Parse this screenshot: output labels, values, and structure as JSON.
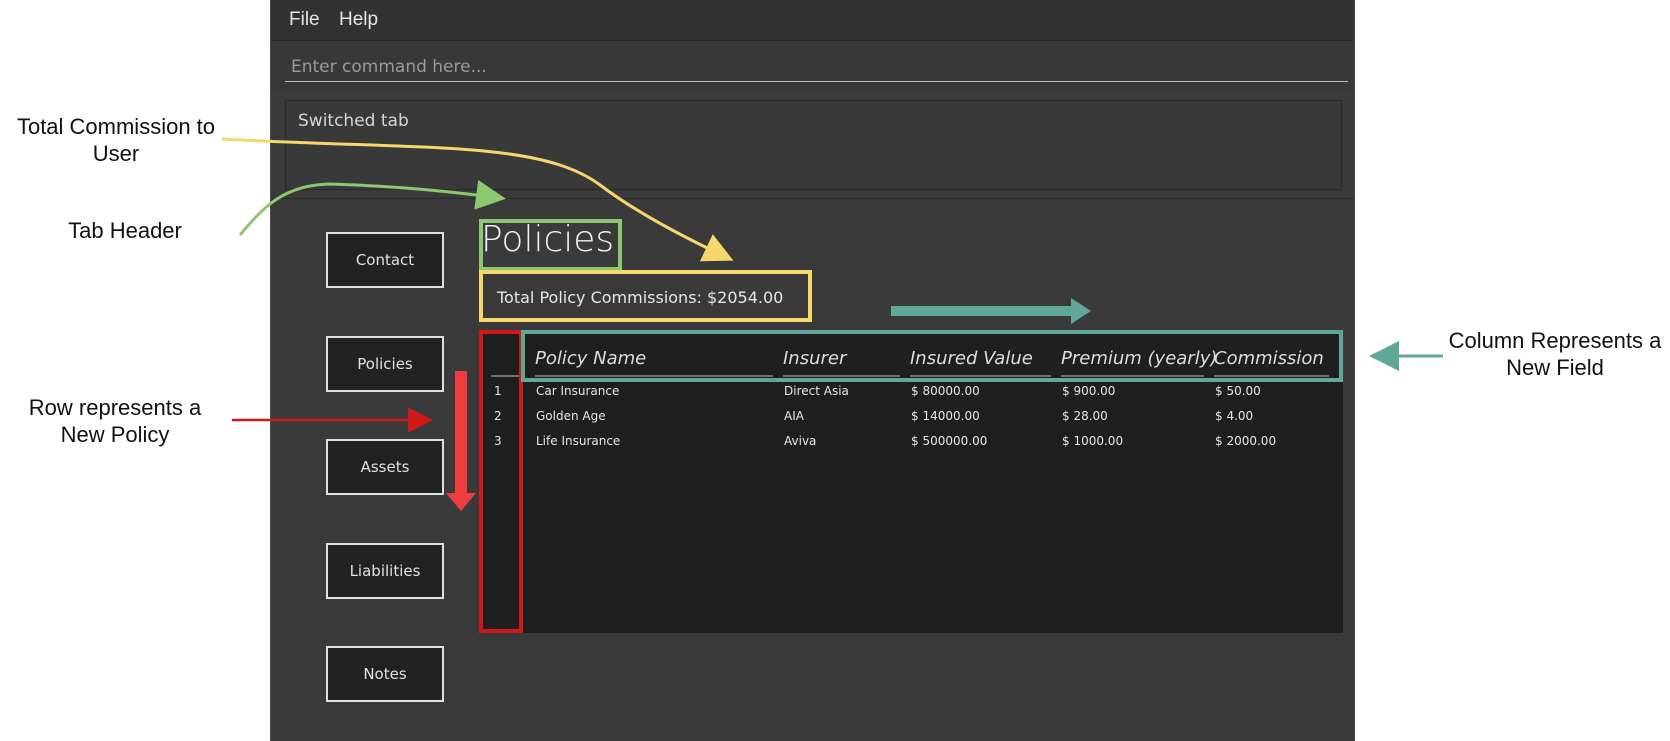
{
  "menu": {
    "file": "File",
    "help": "Help"
  },
  "command": {
    "placeholder": "Enter command here..."
  },
  "result": {
    "text": "Switched tab"
  },
  "nav": [
    {
      "label": "Contact"
    },
    {
      "label": "Policies"
    },
    {
      "label": "Assets"
    },
    {
      "label": "Liabilities"
    },
    {
      "label": "Notes"
    }
  ],
  "tab": {
    "title": "Policies"
  },
  "commission": {
    "text": "Total Policy Commissions: $2054.00"
  },
  "table": {
    "headers": [
      "Policy Name",
      "Insurer",
      "Insured Value",
      "Premium (yearly)",
      "Commission"
    ],
    "rows": [
      {
        "index": "1",
        "name": "Car Insurance",
        "insurer": "Direct Asia",
        "value": "$ 80000.00",
        "premium": "$ 900.00",
        "commission": "$ 50.00"
      },
      {
        "index": "2",
        "name": "Golden Age",
        "insurer": "AIA",
        "value": "$ 14000.00",
        "premium": "$ 28.00",
        "commission": "$ 4.00"
      },
      {
        "index": "3",
        "name": "Life Insurance",
        "insurer": "Aviva",
        "value": "$ 500000.00",
        "premium": "$ 1000.00",
        "commission": "$ 2000.00"
      }
    ]
  },
  "annotations": {
    "total_commission": "Total Commission to User",
    "tab_header": "Tab Header",
    "row": "Row represents a New Policy",
    "column": "Column Represents a New Field"
  },
  "colors": {
    "green": "#8cc870",
    "yellow": "#f5d76e",
    "red": "#d01818",
    "teal": "#5fa898",
    "arrow_red": "#f03c3c"
  }
}
